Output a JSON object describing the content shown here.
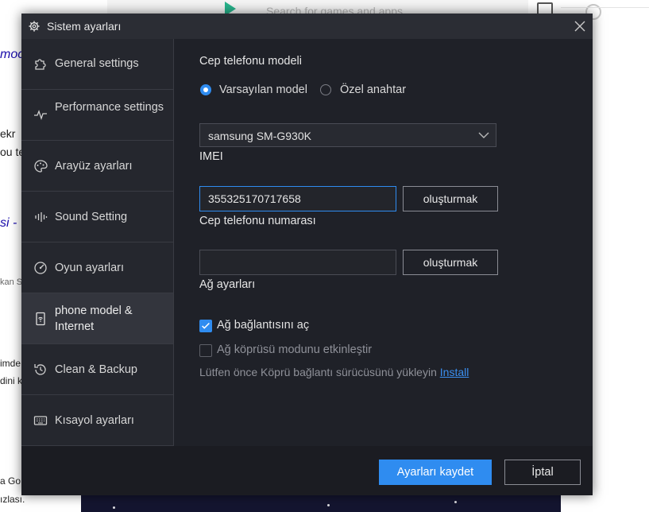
{
  "background": {
    "store_search_placeholder": "Search for games and apps",
    "left_snippets": [
      "moc",
      "ekr",
      "ou te",
      "si -",
      "kan S",
      "imde",
      "dini k",
      "a Go",
      "ızlası."
    ]
  },
  "dialog": {
    "title": "Sistem ayarları",
    "sidebar": [
      {
        "label": "General settings",
        "icon": "puzzle-icon"
      },
      {
        "label": "Performance settings",
        "icon": "pulse-icon"
      },
      {
        "label": "Arayüz ayarları",
        "icon": "palette-icon"
      },
      {
        "label": "Sound Setting",
        "icon": "sound-icon"
      },
      {
        "label": "Oyun ayarları",
        "icon": "gamepad-icon"
      },
      {
        "label": "phone model & Internet",
        "icon": "phone-wifi-icon",
        "active": true
      },
      {
        "label": "Clean & Backup",
        "icon": "history-icon"
      },
      {
        "label": "Kısayol ayarları",
        "icon": "keyboard-icon"
      }
    ],
    "phone_model": {
      "section_title": "Cep telefonu modeli",
      "option_default": "Varsayılan model",
      "option_custom": "Özel anahtar",
      "selected_model": "samsung SM-G930K"
    },
    "imei": {
      "label": "IMEI",
      "value": "355325170717658",
      "generate_button": "oluşturmak"
    },
    "phone_number": {
      "label": "Cep telefonu numarası",
      "value": "",
      "generate_button": "oluşturmak"
    },
    "network": {
      "section_title": "Ağ ayarları",
      "open_connection": "Ağ bağlantısını aç",
      "bridge_mode": "Ağ köprüsü modunu etkinleştir",
      "hint": "Lütfen önce Köprü bağlantı sürücüsünü yükleyin",
      "install_link": "Install"
    },
    "footer": {
      "save_button": "Ayarları kaydet",
      "cancel_button": "İptal"
    }
  },
  "colors": {
    "accent": "#2f8cf0",
    "dialog_bg": "#1f2128",
    "sidebar_bg": "#25272e"
  }
}
